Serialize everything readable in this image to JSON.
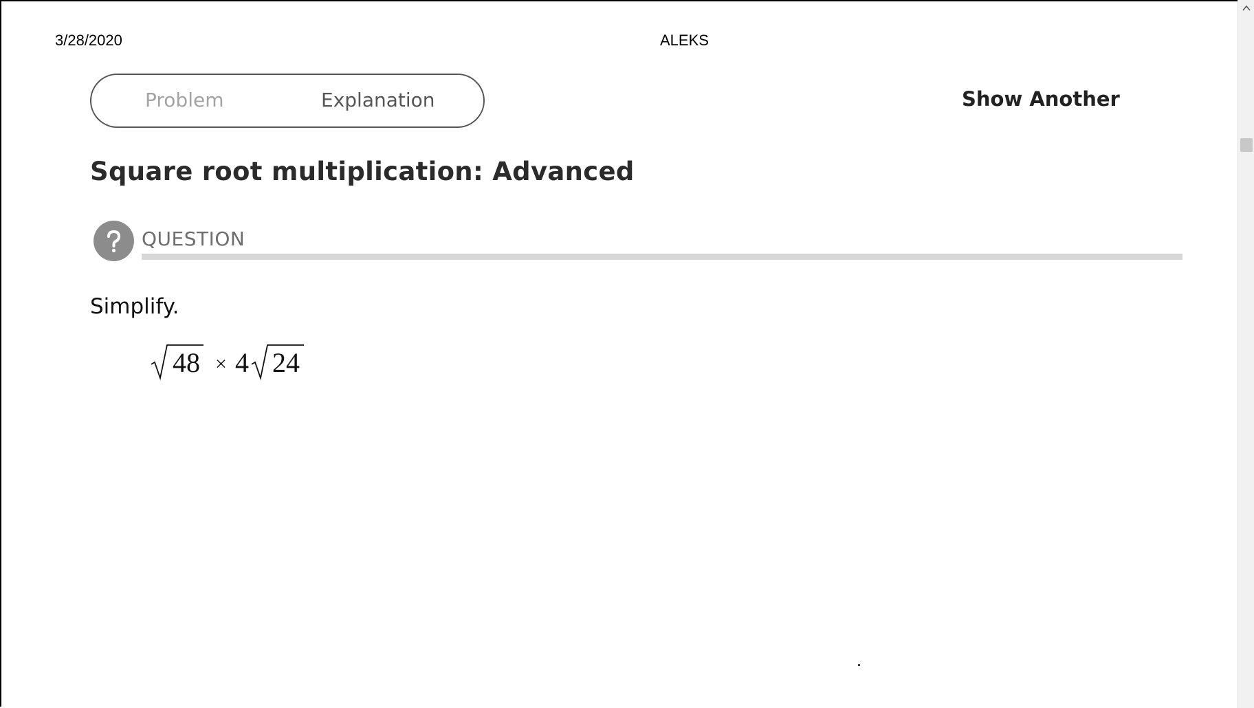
{
  "header": {
    "date": "3/28/2020",
    "title": "ALEKS"
  },
  "tabs": [
    {
      "label": "Problem",
      "active": false
    },
    {
      "label": "Explanation",
      "active": true
    }
  ],
  "actions": {
    "show_another": "Show Another"
  },
  "problem": {
    "title": "Square root multiplication: Advanced",
    "section_label": "QUESTION",
    "instruction": "Simplify.",
    "expression": {
      "radicand_1": "48",
      "operator": "×",
      "coefficient_2": "4",
      "radicand_2": "24"
    }
  },
  "icons": {
    "question": "question-mark-circle-icon",
    "scroll_up": "chevron-up-icon"
  },
  "colors": {
    "icon_bg": "#8c8c8c",
    "rule": "#d7d7d7",
    "inactive_tab": "#a3a3a3",
    "active_tab": "#555555"
  }
}
